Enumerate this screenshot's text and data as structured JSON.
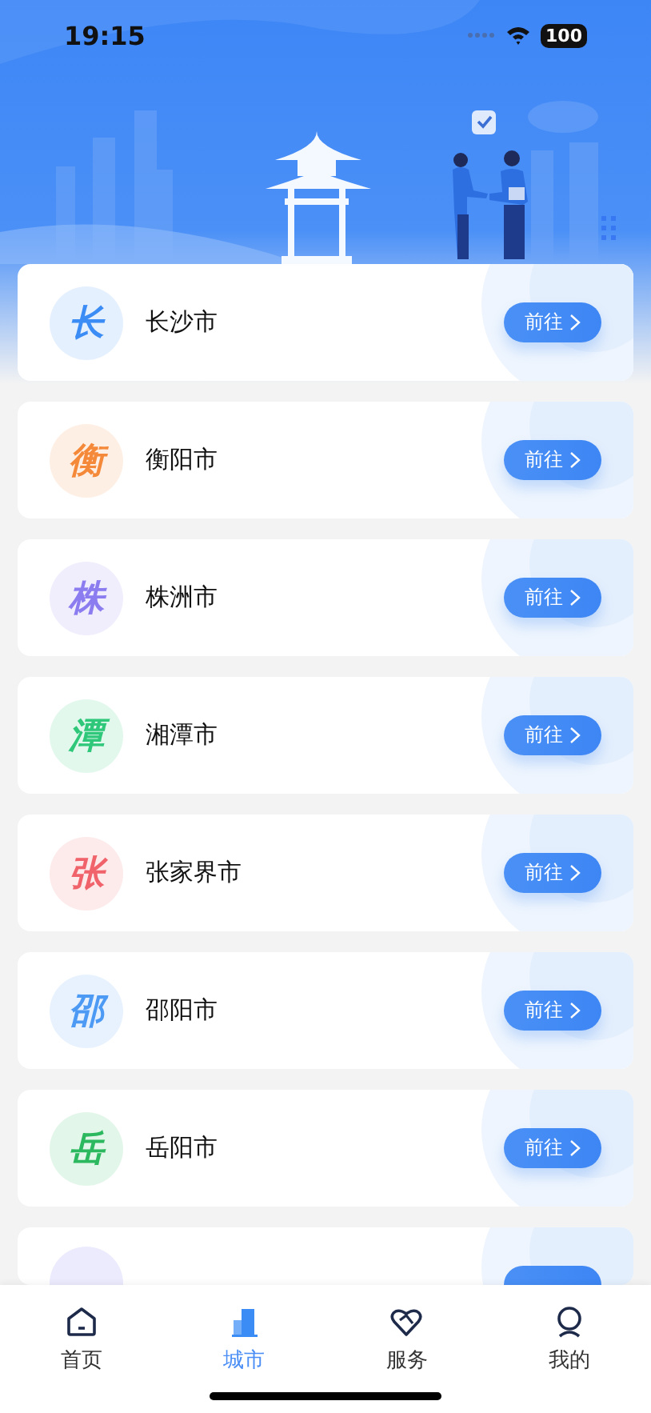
{
  "status_bar": {
    "time": "19:15",
    "battery": "100"
  },
  "cities": [
    {
      "badge": "长",
      "name": "长沙市",
      "button": "前往",
      "color": "#3b8cf5"
    },
    {
      "badge": "衡",
      "name": "衡阳市",
      "button": "前往",
      "color": "#f5893a"
    },
    {
      "badge": "株",
      "name": "株洲市",
      "button": "前往",
      "color": "#8b7cf0"
    },
    {
      "badge": "潭",
      "name": "湘潭市",
      "button": "前往",
      "color": "#2fc77a"
    },
    {
      "badge": "张",
      "name": "张家界市",
      "button": "前往",
      "color": "#f0636a"
    },
    {
      "badge": "邵",
      "name": "邵阳市",
      "button": "前往",
      "color": "#4d9af5"
    },
    {
      "badge": "岳",
      "name": "岳阳市",
      "button": "前往",
      "color": "#2cb85e"
    }
  ],
  "tab_bar": [
    {
      "kind": "home",
      "label": "首页",
      "selected": false
    },
    {
      "kind": "city",
      "label": "城市",
      "selected": true
    },
    {
      "kind": "service",
      "label": "服务",
      "selected": false
    },
    {
      "kind": "mine",
      "label": "我的",
      "selected": false
    }
  ]
}
